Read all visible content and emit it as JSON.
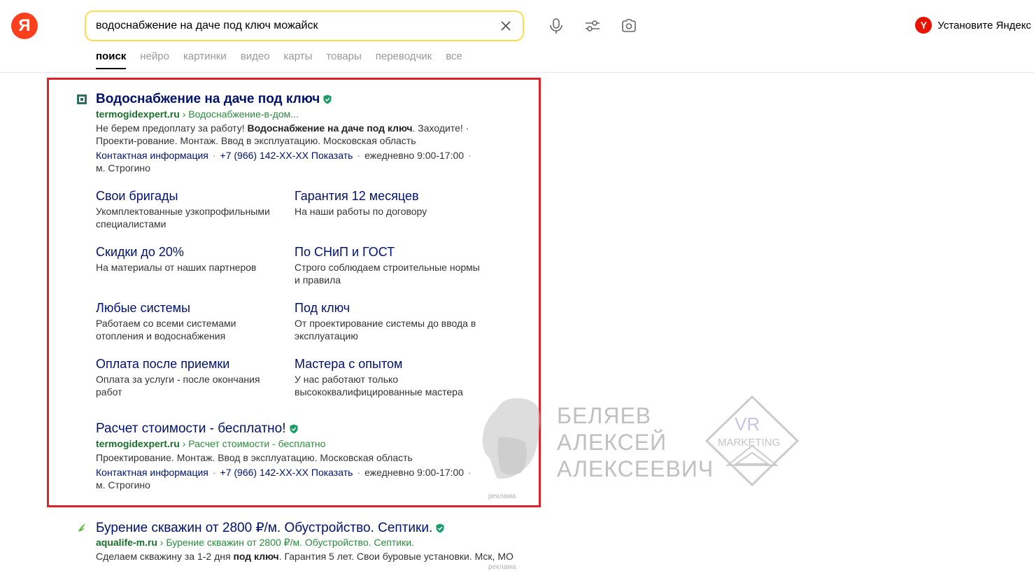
{
  "header": {
    "logo": "Я",
    "search_value": "водоснабжение на даче под ключ можайск",
    "install_label": "Установите Яндекс",
    "browser_logo": "Y"
  },
  "tabs": [
    {
      "label": "поиск",
      "active": true
    },
    {
      "label": "нейро"
    },
    {
      "label": "картинки"
    },
    {
      "label": "видео"
    },
    {
      "label": "карты"
    },
    {
      "label": "товары"
    },
    {
      "label": "переводчик"
    },
    {
      "label": "все"
    }
  ],
  "ad1": {
    "title": "Водоснабжение на даче под ключ",
    "domain": "termogidexpert.ru",
    "path": "› Водоснабжение-в-дом...",
    "desc_before": "Не берем предоплату за работу! ",
    "desc_bold": "Водоснабжение на даче под ключ",
    "desc_after": ". Заходите! · Проекти-рование. Монтаж. Ввод в эксплуатацию. Московская область",
    "contact_link": "Контактная информация",
    "phone": "+7 (966) 142-XX-XX Показать",
    "hours": "ежедневно 9:00-17:00",
    "metro": "м. Строгино",
    "sitelinks": [
      {
        "title": "Свои бригады",
        "desc": "Укомплектованные узкопрофильными специалистами"
      },
      {
        "title": "Гарантия 12 месяцев",
        "desc": "На наши работы по договору"
      },
      {
        "title": "Скидки до 20%",
        "desc": "На материалы от наших партнеров"
      },
      {
        "title": "По СНиП и ГОСТ",
        "desc": "Строго соблюдаем строительные нормы и правила"
      },
      {
        "title": "Любые системы",
        "desc": "Работаем со всеми системами отопления и водоснабжения"
      },
      {
        "title": "Под ключ",
        "desc": "От проектирование системы до ввода в эксплуатацию"
      },
      {
        "title": "Оплата после приемки",
        "desc": "Оплата за услуги - после окончания работ"
      },
      {
        "title": "Мастера с опытом",
        "desc": "У нас работают только высококвалифицированные мастера"
      }
    ],
    "ad_label": "реклама"
  },
  "ad2": {
    "title": "Расчет стоимости - бесплатно!",
    "domain": "termogidexpert.ru",
    "path": "› Расчет стоимости - бесплатно",
    "desc": "Проектирование. Монтаж. Ввод в эксплуатацию. Московская область",
    "contact_link": "Контактная информация",
    "phone": "+7 (966) 142-XX-XX Показать",
    "hours": "ежедневно 9:00-17:00",
    "metro": "м. Строгино"
  },
  "ad3": {
    "title": "Бурение скважин от 2800 ₽/м. Обустройство. Септики.",
    "domain": "aqualife-m.ru",
    "path": "› Бурение скважин от 2800 ₽/м. Обустройство. Септики.",
    "desc_before": "Сделаем скважину за 1-2 дня ",
    "desc_bold": "под ключ",
    "desc_after": ". Гарантия 5 лет. Свои буровые установки. Мск, МО",
    "ad_label": "реклама"
  },
  "watermark": {
    "line1": "БЕЛЯЕВ",
    "line2": "АЛЕКСЕЙ",
    "line3": "АЛЕКСЕЕВИЧ",
    "brand_top": "VR",
    "brand_bottom": "MARKETING"
  },
  "colors": {
    "link": "#00126e",
    "url_green": "#2b8a3e",
    "frame_red": "#e0222a",
    "search_border": "#ffdb4d",
    "logo_red": "#fc3f1d"
  }
}
